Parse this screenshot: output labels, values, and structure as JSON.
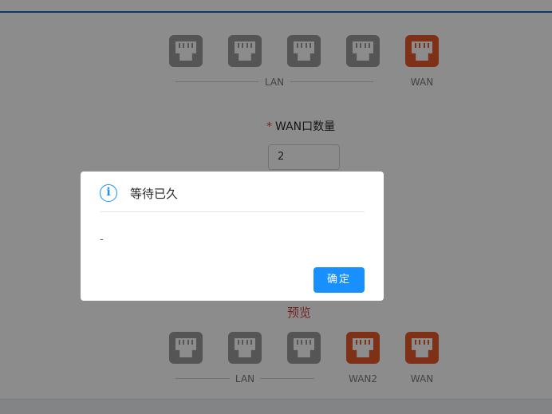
{
  "top_ports": {
    "lan_label": "LAN",
    "wan_label": "WAN"
  },
  "wan_count_field": {
    "label": "WAN口数量",
    "required_mark": "*",
    "value": "2"
  },
  "preview": {
    "title": "预览",
    "lan_label": "LAN",
    "wan2_label": "WAN2",
    "wan_label": "WAN"
  },
  "modal": {
    "icon": "info-icon",
    "title": "等待已久",
    "body": "-",
    "ok_label": "确定"
  },
  "colors": {
    "port_gray": "#9b9b9b",
    "port_wan": "#e55a2b",
    "primary": "#1890ff",
    "preview_title": "#d64545"
  }
}
